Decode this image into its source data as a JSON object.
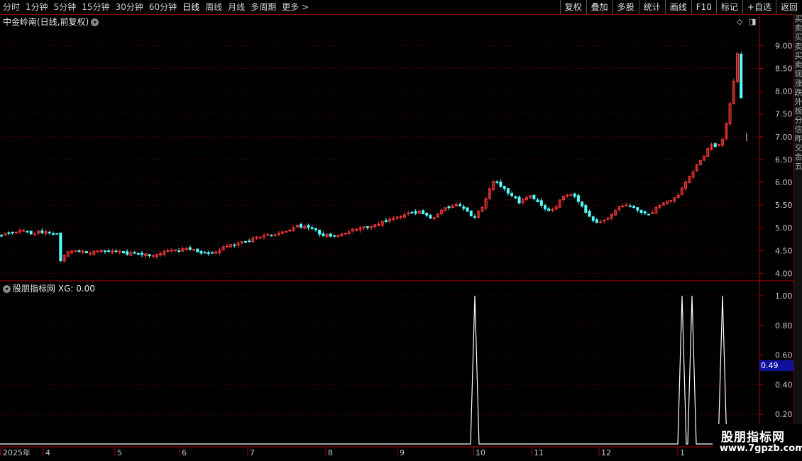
{
  "toolbar": {
    "periods": [
      {
        "label": "分时"
      },
      {
        "label": "1分钟"
      },
      {
        "label": "5分钟"
      },
      {
        "label": "15分钟"
      },
      {
        "label": "30分钟"
      },
      {
        "label": "60分钟"
      },
      {
        "label": "日线",
        "active": true
      },
      {
        "label": "周线"
      },
      {
        "label": "月线"
      },
      {
        "label": "多周期"
      },
      {
        "label": "更多 >"
      }
    ],
    "tools": [
      {
        "label": "复权"
      },
      {
        "label": "叠加"
      },
      {
        "label": "多股"
      },
      {
        "label": "统计"
      },
      {
        "label": "画线"
      },
      {
        "label": "F10"
      },
      {
        "label": "标记"
      },
      {
        "label": "+自选"
      },
      {
        "label": "返回"
      }
    ]
  },
  "main_chart": {
    "title": "中金岭南(日线,前复权)",
    "price_ticks": [
      "9.00",
      "8.50",
      "8.00",
      "7.50",
      "7.00",
      "6.50",
      "6.00",
      "5.50",
      "5.00",
      "4.50",
      "4.00"
    ],
    "controls": {
      "diamond": "◇",
      "toggle": "◨"
    }
  },
  "indicator": {
    "title": "股朋指标网",
    "value_text": "XG: 0.00",
    "ticks": [
      "1.00",
      "0.80",
      "0.60",
      "0.40",
      "0.20"
    ],
    "cursor_value": "0.49"
  },
  "date_axis": {
    "labels": [
      "2025年",
      "4",
      "5",
      "6",
      "7",
      "8",
      "9",
      "10",
      "11",
      "12",
      "1"
    ]
  },
  "sidebar_text": [
    "买",
    "卖",
    "买",
    "卖",
    "买",
    "卖",
    "现",
    "涨",
    "跌",
    "外",
    "板",
    "分",
    "信",
    "昨",
    "交",
    "金",
    "五"
  ],
  "watermark": {
    "line1": "股朋指标网",
    "line2": "www.7gpzb.com"
  },
  "colors": {
    "up": "#ff3a3a",
    "down": "#54ffff",
    "grid": "#7a0000",
    "axis": "#b00000"
  },
  "chart_data": [
    {
      "type": "candlestick",
      "title": "中金岭南(日线,前复权)",
      "ylim": [
        3.85,
        9.35
      ],
      "x_labels": [
        "2025年",
        "4",
        "5",
        "6",
        "7",
        "8",
        "9",
        "10",
        "11",
        "12",
        "1"
      ],
      "close_path": [
        [
          0,
          4.85
        ],
        [
          5,
          4.87
        ],
        [
          10,
          4.9
        ],
        [
          15,
          4.95
        ],
        [
          20,
          4.92
        ],
        [
          25,
          4.88
        ],
        [
          30,
          4.9
        ],
        [
          35,
          4.89
        ],
        [
          40,
          4.87
        ],
        [
          45,
          4.85
        ],
        [
          47,
          4.5
        ],
        [
          48,
          4.3
        ],
        [
          50,
          4.4
        ],
        [
          55,
          4.5
        ],
        [
          60,
          4.52
        ],
        [
          65,
          4.5
        ],
        [
          70,
          4.45
        ],
        [
          75,
          4.48
        ],
        [
          80,
          4.52
        ],
        [
          90,
          4.48
        ],
        [
          100,
          4.45
        ],
        [
          110,
          4.42
        ],
        [
          120,
          4.4
        ],
        [
          130,
          4.45
        ],
        [
          140,
          4.5
        ],
        [
          150,
          4.52
        ],
        [
          160,
          4.48
        ],
        [
          170,
          4.42
        ],
        [
          180,
          4.55
        ],
        [
          190,
          4.65
        ],
        [
          200,
          4.72
        ],
        [
          210,
          4.8
        ],
        [
          220,
          4.85
        ],
        [
          230,
          4.9
        ],
        [
          240,
          5.05
        ],
        [
          250,
          5.0
        ],
        [
          260,
          4.85
        ],
        [
          270,
          4.82
        ],
        [
          280,
          4.9
        ],
        [
          290,
          5.0
        ],
        [
          300,
          5.05
        ],
        [
          310,
          5.12
        ],
        [
          320,
          5.2
        ],
        [
          330,
          5.3
        ],
        [
          340,
          5.35
        ],
        [
          350,
          5.2
        ],
        [
          360,
          5.45
        ],
        [
          370,
          5.5
        ],
        [
          380,
          5.3
        ],
        [
          385,
          5.25
        ],
        [
          390,
          5.45
        ],
        [
          395,
          5.8
        ],
        [
          400,
          6.05
        ],
        [
          405,
          5.9
        ],
        [
          410,
          5.8
        ],
        [
          415,
          5.7
        ],
        [
          420,
          5.55
        ],
        [
          425,
          5.65
        ],
        [
          430,
          5.7
        ],
        [
          435,
          5.6
        ],
        [
          440,
          5.4
        ],
        [
          445,
          5.35
        ],
        [
          450,
          5.45
        ],
        [
          455,
          5.7
        ],
        [
          460,
          5.75
        ],
        [
          465,
          5.7
        ],
        [
          470,
          5.5
        ],
        [
          475,
          5.3
        ],
        [
          480,
          5.15
        ],
        [
          485,
          5.1
        ],
        [
          490,
          5.15
        ],
        [
          495,
          5.3
        ],
        [
          500,
          5.45
        ],
        [
          505,
          5.5
        ],
        [
          510,
          5.45
        ],
        [
          515,
          5.4
        ],
        [
          520,
          5.35
        ],
        [
          525,
          5.3
        ],
        [
          530,
          5.4
        ],
        [
          535,
          5.5
        ],
        [
          540,
          5.6
        ],
        [
          545,
          5.65
        ],
        [
          550,
          5.75
        ],
        [
          555,
          6.0
        ],
        [
          560,
          6.2
        ],
        [
          565,
          6.4
        ],
        [
          570,
          6.6
        ],
        [
          575,
          6.85
        ],
        [
          580,
          6.75
        ],
        [
          585,
          6.95
        ],
        [
          590,
          7.5
        ],
        [
          592,
          7.95
        ],
        [
          594,
          8.2
        ],
        [
          596,
          8.5
        ],
        [
          598,
          9.1
        ],
        [
          600,
          7.85
        ],
        [
          602,
          7.95
        ]
      ]
    },
    {
      "type": "line",
      "title": "股朋指标网",
      "series": [
        {
          "name": "XG",
          "spikes_at_dates": [
            "10月初",
            "1月上旬",
            "1月上旬",
            "1月中旬"
          ],
          "values": [
            1,
            1,
            1,
            1
          ]
        }
      ],
      "ylim": [
        0,
        1.05
      ]
    }
  ]
}
